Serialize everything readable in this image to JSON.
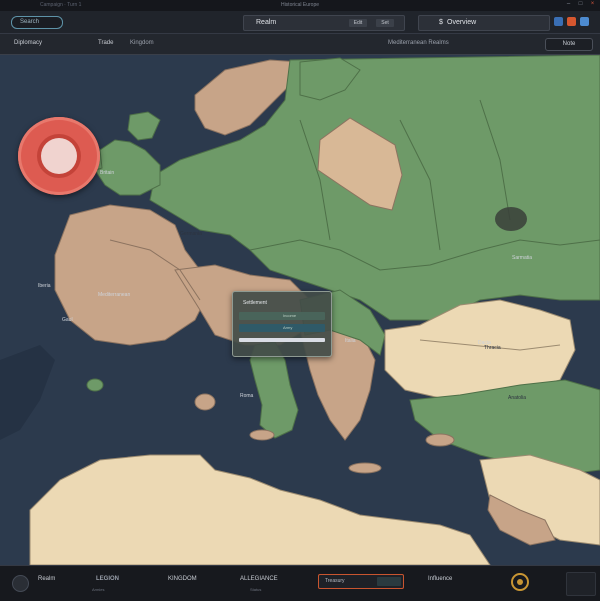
{
  "window": {
    "title": "Historical Europe",
    "left_text": "Campaign · Turn 1",
    "control_icons": [
      "minimize-icon",
      "maximize-icon",
      "close-icon"
    ]
  },
  "topbar": {
    "search_label": "Search",
    "center_label": "Realm",
    "center_buttons": [
      "Edit",
      "Set"
    ],
    "right_label": "Overview",
    "right_prefix": "$",
    "icons": [
      "notification-icon",
      "alert-icon",
      "globe-icon"
    ],
    "icon_colors": [
      "#3a6fb5",
      "#d6572f",
      "#4d8bd0"
    ]
  },
  "subbar": {
    "item1": "Diplomacy",
    "item2": "Trade",
    "item3": "Kingdom",
    "item4": "Mediterranean Realms",
    "note_button": "Note"
  },
  "map": {
    "labels": [
      {
        "text": "Britain",
        "style": "light"
      },
      {
        "text": "Iberia",
        "style": "light"
      },
      {
        "text": "Gaul",
        "style": "light"
      },
      {
        "text": "Germania",
        "style": "dark"
      },
      {
        "text": "Sarmatia",
        "style": "light"
      },
      {
        "text": "Italia",
        "style": "light"
      },
      {
        "text": "Roma",
        "style": "light"
      },
      {
        "text": "Dacia",
        "style": "light"
      },
      {
        "text": "Anatolia",
        "style": "dark"
      },
      {
        "text": "Thracia",
        "style": "dark"
      },
      {
        "text": "Mediterranean",
        "style": "light"
      }
    ],
    "colors": {
      "sea": "#2c3a4d",
      "green": "#6e9a68",
      "tan": "#c7a488",
      "beige": "#ecd9b4",
      "faction_red": "#dd5b51"
    },
    "popup": {
      "title": "Settlement",
      "row1": "Income",
      "row2": "Army"
    }
  },
  "bottombar": {
    "item1": "Realm",
    "item2": "LEGION",
    "item2_sub": "Armies",
    "item3": "KINGDOM",
    "item4": "ALLEGIANCE",
    "item4_sub": "Status",
    "field_label": "Treasury",
    "item5": "Influence"
  }
}
